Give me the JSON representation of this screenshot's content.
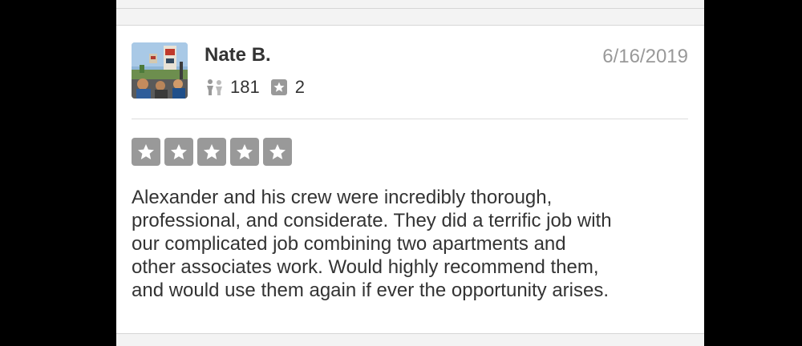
{
  "review": {
    "user_name": "Nate B.",
    "date": "6/16/2019",
    "stats": {
      "friends_count": "181",
      "reviews_count": "2"
    },
    "rating": {
      "stars": 5,
      "max": 5
    },
    "text_lines": [
      "Alexander and his crew were incredibly thorough,",
      "professional, and considerate. They did a terrific job with",
      "our complicated job combining two apartments and",
      "other associates work. Would highly recommend them,",
      "and would use them again if ever the opportunity arises."
    ]
  },
  "icons": {
    "avatar": "user-avatar-photo",
    "friends": "friends-icon",
    "reviews": "review-star-icon",
    "rating_star": "star-icon"
  },
  "colors": {
    "star_box": "#999999",
    "name_text": "#333333",
    "date_text": "#999999",
    "body_text": "#333333",
    "card_background": "#ffffff",
    "page_background": "#f3f3f3"
  }
}
